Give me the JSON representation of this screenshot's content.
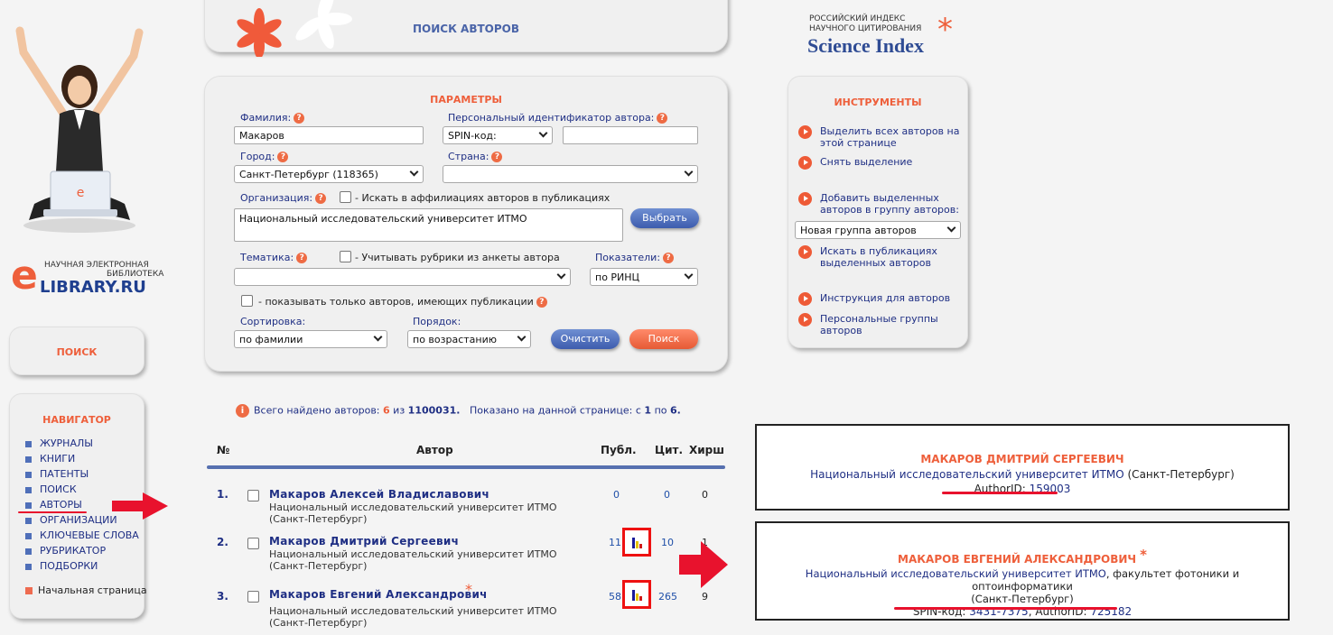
{
  "header": {
    "title": "ПОИСК АВТОРОВ",
    "brand_line1": "РОССИЙСКИЙ ИНДЕКС",
    "brand_line2": "НАУЧНОГО ЦИТИРОВАНИЯ",
    "brand_name": "Science Index"
  },
  "logo": {
    "line1": "НАУЧНАЯ ЭЛЕКТРОННАЯ",
    "line2": "БИБЛИОТЕКА",
    "name": "LIBRARY.RU",
    "initial": "e"
  },
  "left": {
    "search_label": "ПОИСК",
    "navigator_title": "НАВИГАТОР",
    "nav_items": [
      "ЖУРНАЛЫ",
      "КНИГИ",
      "ПАТЕНТЫ",
      "ПОИСК",
      "АВТОРЫ",
      "ОРГАНИЗАЦИИ",
      "КЛЮЧЕВЫЕ СЛОВА",
      "РУБРИКАТОР",
      "ПОДБОРКИ"
    ],
    "home": "Начальная страница"
  },
  "params": {
    "title": "ПАРАМЕТРЫ",
    "surname_label": "Фамилия:",
    "surname_value": "Макаров",
    "author_id_label": "Персональный идентификатор автора:",
    "id_type_value": "SPIN-код:",
    "id_value": "",
    "city_label": "Город:",
    "city_value": "Санкт-Петербург  (118365)",
    "country_label": "Страна:",
    "country_value": "",
    "org_label": "Организация:",
    "affil_checkbox": "- Искать в аффилиациях авторов в публикациях",
    "org_value": "Национальный исследовательский университет ИТМО",
    "choose_button": "Выбрать",
    "topic_label": "Тематика:",
    "topic_checkbox": "- Учитывать рубрики из анкеты автора",
    "topic_value": "",
    "indicators_label": "Показатели:",
    "indicators_value": "по РИНЦ",
    "only_pubs_checkbox": "- показывать только авторов, имеющих публикации",
    "sort_label": "Сортировка:",
    "sort_value": "по фамилии",
    "order_label": "Порядок:",
    "order_value": "по возрастанию",
    "clear_button": "Очистить",
    "search_button": "Поиск"
  },
  "tools": {
    "title": "ИНСТРУМЕНТЫ",
    "select_all": "Выделить всех авторов на этой странице",
    "deselect": "Снять выделение",
    "add_to_group": "Добавить выделенных авторов в группу авторов:",
    "group_value": "Новая группа авторов",
    "search_pubs": "Искать в публикациях выделенных авторов",
    "instructions": "Инструкция для авторов",
    "personal_groups": "Персональные группы авторов"
  },
  "results": {
    "found_prefix": "Всего найдено авторов:",
    "found_count": "6",
    "found_of": "из",
    "found_total": "1100031.",
    "shown_prefix": "Показано на данной странице: с",
    "shown_from": "1",
    "shown_to_word": "по",
    "shown_to": "6.",
    "col_num": "№",
    "col_author": "Автор",
    "col_pubs": "Публ.",
    "col_cit": "Цит.",
    "col_hirsch": "Хирш",
    "rows": [
      {
        "num": "1.",
        "name": "Макаров  Алексей  Владиславович",
        "affiliation": "Национальный исследовательский университет ИТМО (Санкт-Петербург)",
        "pubs": "0",
        "cit": "0",
        "hirsch": "0",
        "star": ""
      },
      {
        "num": "2.",
        "name": "Макаров  Дмитрий  Сергеевич",
        "affiliation": "Национальный исследовательский университет ИТМО (Санкт-Петербург)",
        "pubs": "11",
        "cit": "10",
        "hirsch": "1",
        "star": ""
      },
      {
        "num": "3.",
        "name": "Макаров  Евгений  Александрович",
        "affiliation": "Национальный исследовательский университет ИТМО (Санкт-Петербург)",
        "pubs": "58",
        "cit": "265",
        "hirsch": "9",
        "star": "*"
      }
    ]
  },
  "card1": {
    "name": "МАКАРОВ ДМИТРИЙ СЕРГЕЕВИЧ",
    "org": "Национальный исследовательский университет ИТМО",
    "city": " (Санкт-Петербург)",
    "id_label": "AuthorID: ",
    "id_value": "159003"
  },
  "card2": {
    "name": "МАКАРОВ ЕВГЕНИЙ АЛЕКСАНДРОВИЧ",
    "star": "*",
    "org": "Национальный исследовательский университет ИТМО",
    "org_rest": ", факультет фотоники и оптоинформатики",
    "city": "(Санкт-Петербург)",
    "spin_label": "SPIN-код: ",
    "spin_value": "3431-7375",
    "id_label": ", AuthorID: ",
    "id_value": "725182"
  },
  "colors": {
    "accent": "#ee5f3b",
    "navy": "#1f2f84",
    "highlight": "#e8122d"
  }
}
